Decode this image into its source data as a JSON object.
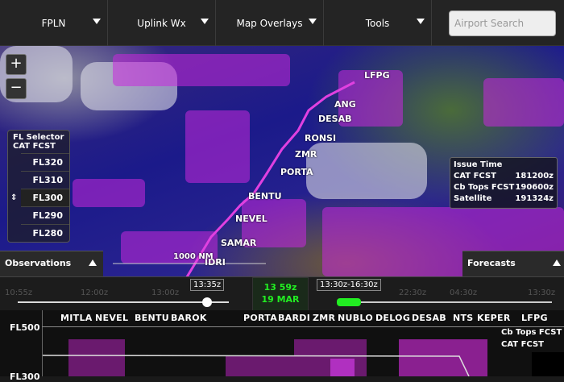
{
  "menu": [
    {
      "label": "FPLN"
    },
    {
      "label": "Uplink Wx"
    },
    {
      "label": "Map Overlays"
    },
    {
      "label": "Tools"
    }
  ],
  "search": {
    "placeholder": "Airport Search"
  },
  "map": {
    "zoom_in": "+",
    "zoom_out": "−",
    "scale_label": "1000 NM",
    "waypoints": [
      "LFPG",
      "ANG",
      "DESAB",
      "RONSI",
      "ZMR",
      "PORTA",
      "BENTU",
      "NEVEL",
      "SAMAR",
      "IDRI"
    ],
    "route_color": "#e040e0"
  },
  "fl_selector": {
    "title": "FL Selector",
    "subtitle": "CAT FCST",
    "levels": [
      "FL320",
      "FL310",
      "FL300",
      "FL290",
      "FL280"
    ],
    "selected": "FL300"
  },
  "issue_time": {
    "title": "Issue Time",
    "rows": [
      {
        "label": "CAT FCST",
        "value": "181200z"
      },
      {
        "label": "Cb Tops FCST",
        "value": "190600z"
      },
      {
        "label": "Satellite",
        "value": "191324z"
      }
    ]
  },
  "tabs": {
    "observations": "Observations",
    "forecasts": "Forecasts"
  },
  "timeline": {
    "obs_ticks": [
      "10:55z",
      "12:00z",
      "13:00z"
    ],
    "obs_selected": "13:35z",
    "current_time": "13 59z",
    "current_date": "19 MAR",
    "fcst_selected": "13:30z-16:30z",
    "fcst_ticks": [
      "22:30z",
      "04:30z",
      "13:30z"
    ],
    "accent": "#22ee22"
  },
  "profile": {
    "level_top": "FL500",
    "level_bottom": "FL300",
    "waypoints": [
      "MITLA",
      "NEVEL",
      "BENTU",
      "BAROK",
      "PORTA",
      "BARDI",
      "ZMR",
      "NUBLO",
      "DELOG",
      "DESAB",
      "NTS",
      "KEPER",
      "LFPG"
    ],
    "legend": [
      "Cb Tops FCST",
      "CAT FCST"
    ]
  }
}
